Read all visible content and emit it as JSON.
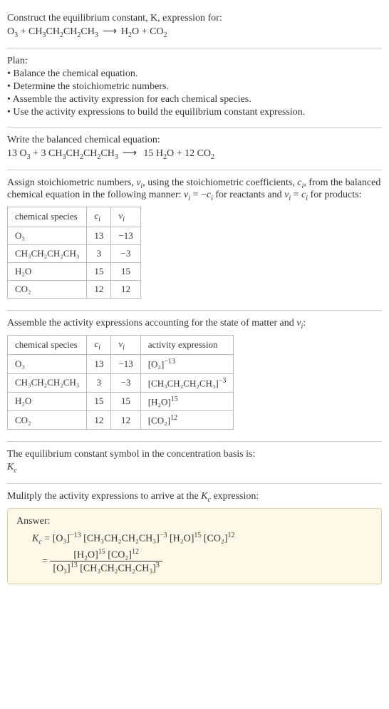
{
  "s1": {
    "prompt": "Construct the equilibrium constant, K, expression for:",
    "equation_lhs1": "O",
    "equation_lhs1_sub": "3",
    "plus": " + ",
    "equation_lhs2": "CH",
    "equation_lhs2_sub1": "3",
    "equation_lhs2b": "CH",
    "equation_lhs2_sub2": "2",
    "equation_lhs2c": "CH",
    "equation_lhs2_sub3": "2",
    "equation_lhs2d": "CH",
    "equation_lhs2_sub4": "3",
    "arrow": "⟶",
    "equation_rhs1": "H",
    "equation_rhs1_sub": "2",
    "equation_rhs1b": "O",
    "equation_rhs2": "CO",
    "equation_rhs2_sub": "2"
  },
  "plan": {
    "title": "Plan:",
    "b1": "• Balance the chemical equation.",
    "b2": "• Determine the stoichiometric numbers.",
    "b3": "• Assemble the activity expression for each chemical species.",
    "b4": "• Use the activity expressions to build the equilibrium constant expression."
  },
  "s2": {
    "label": "Write the balanced chemical equation:",
    "c1": "13 ",
    "c2": " + 3 ",
    "c3": " 15 ",
    "c4": " + 12 "
  },
  "s3": {
    "p1a": "Assign stoichiometric numbers, ",
    "nu_i": "ν",
    "sub_i": "i",
    "p1b": ", using the stoichiometric coefficients, ",
    "c_i": "c",
    "p1c": ", from the balanced chemical equation in the following manner: ",
    "eq1": " = −",
    "p1d": " for reactants and ",
    "eq2": " = ",
    "p1e": " for products:",
    "h1": "chemical species",
    "h2": "c",
    "h3": "ν",
    "r1": {
      "sp": "O₃",
      "c": "13",
      "v": "−13"
    },
    "r2": {
      "sp": "CH₃CH₂CH₂CH₃",
      "c": "3",
      "v": "−3"
    },
    "r3": {
      "sp": "H₂O",
      "c": "15",
      "v": "15"
    },
    "r4": {
      "sp": "CO₂",
      "c": "12",
      "v": "12"
    }
  },
  "s4": {
    "p1a": "Assemble the activity expressions accounting for the state of matter and ",
    "p1b": ":",
    "h4": "activity expression",
    "a1_base": "[O₃]",
    "a1_exp": "−13",
    "a2_base": "[CH₃CH₂CH₂CH₃]",
    "a2_exp": "−3",
    "a3_base": "[H₂O]",
    "a3_exp": "15",
    "a4_base": "[CO₂]",
    "a4_exp": "12"
  },
  "s5": {
    "p1": "The equilibrium constant symbol in the concentration basis is:",
    "K": "K",
    "c": "c"
  },
  "s6": {
    "p1a": "Mulitply the activity expressions to arrive at the ",
    "p1b": " expression:"
  },
  "answer": {
    "label": "Answer:",
    "eq1_lhs_K": "K",
    "eq1_lhs_c": "c",
    "eq": " = ",
    "t1": "[O₃]",
    "e1": "−13",
    "t2": " [CH₃CH₂CH₂CH₃]",
    "e2": "−3",
    "t3": " [H₂O]",
    "e3": "15",
    "t4": " [CO₂]",
    "e4": "12",
    "num1": "[H₂O]",
    "ne1": "15",
    "num2": " [CO₂]",
    "ne2": "12",
    "den1": "[O₃]",
    "de1": "13",
    "den2": " [CH₃CH₂CH₂CH₃]",
    "de2": "3"
  },
  "chart_data": {
    "type": "table",
    "tables": [
      {
        "title": "Stoichiometric numbers",
        "columns": [
          "chemical species",
          "c_i",
          "ν_i"
        ],
        "rows": [
          [
            "O3",
            13,
            -13
          ],
          [
            "CH3CH2CH2CH3",
            3,
            -3
          ],
          [
            "H2O",
            15,
            15
          ],
          [
            "CO2",
            12,
            12
          ]
        ]
      },
      {
        "title": "Activity expressions",
        "columns": [
          "chemical species",
          "c_i",
          "ν_i",
          "activity expression"
        ],
        "rows": [
          [
            "O3",
            13,
            -13,
            "[O3]^-13"
          ],
          [
            "CH3CH2CH2CH3",
            3,
            -3,
            "[CH3CH2CH2CH3]^-3"
          ],
          [
            "H2O",
            15,
            15,
            "[H2O]^15"
          ],
          [
            "CO2",
            12,
            12,
            "[CO2]^12"
          ]
        ]
      }
    ]
  }
}
